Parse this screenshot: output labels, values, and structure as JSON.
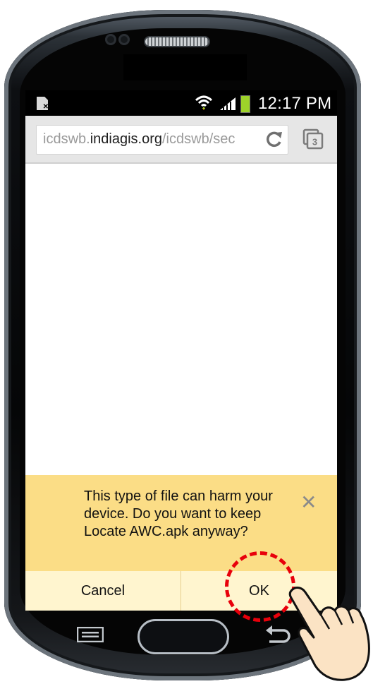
{
  "status_bar": {
    "time": "12:17 PM",
    "icons": [
      "sim-off-icon",
      "wifi-icon",
      "signal-icon",
      "battery-icon"
    ]
  },
  "browser": {
    "url_prefix": "icdswb.",
    "url_domain": "indiagis.org",
    "url_path": "/icdswb/sec",
    "tab_count": "3"
  },
  "download_prompt": {
    "message": "This type of file can harm your device. Do you want to keep Locate AWC.apk anyway?",
    "cancel_label": "Cancel",
    "ok_label": "OK"
  },
  "colors": {
    "prompt_bg": "#fbdd86",
    "buttons_bg": "#fff5cf",
    "highlight": "#e8000b"
  }
}
